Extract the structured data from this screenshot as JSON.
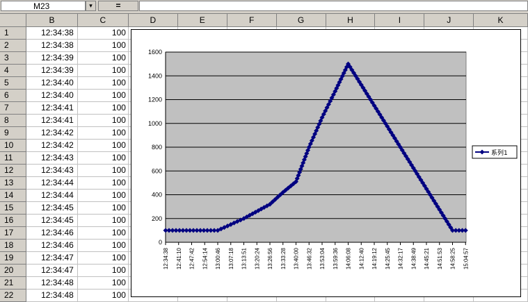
{
  "formula_bar": {
    "name_box": "M23",
    "dropdown_icon": "▾",
    "formula_label": "="
  },
  "columns": [
    "B",
    "C",
    "D",
    "E",
    "F",
    "G",
    "H",
    "I",
    "J",
    "K"
  ],
  "rows": [
    {
      "num": "1",
      "time": "12:34:38",
      "value": "100"
    },
    {
      "num": "2",
      "time": "12:34:38",
      "value": "100"
    },
    {
      "num": "3",
      "time": "12:34:39",
      "value": "100"
    },
    {
      "num": "4",
      "time": "12:34:39",
      "value": "100"
    },
    {
      "num": "5",
      "time": "12:34:40",
      "value": "100"
    },
    {
      "num": "6",
      "time": "12:34:40",
      "value": "100"
    },
    {
      "num": "7",
      "time": "12:34:41",
      "value": "100"
    },
    {
      "num": "8",
      "time": "12:34:41",
      "value": "100"
    },
    {
      "num": "9",
      "time": "12:34:42",
      "value": "100"
    },
    {
      "num": "10",
      "time": "12:34:42",
      "value": "100"
    },
    {
      "num": "11",
      "time": "12:34:43",
      "value": "100"
    },
    {
      "num": "12",
      "time": "12:34:43",
      "value": "100"
    },
    {
      "num": "13",
      "time": "12:34:44",
      "value": "100"
    },
    {
      "num": "14",
      "time": "12:34:44",
      "value": "100"
    },
    {
      "num": "15",
      "time": "12:34:45",
      "value": "100"
    },
    {
      "num": "16",
      "time": "12:34:45",
      "value": "100"
    },
    {
      "num": "17",
      "time": "12:34:46",
      "value": "100"
    },
    {
      "num": "18",
      "time": "12:34:46",
      "value": "100"
    },
    {
      "num": "19",
      "time": "12:34:47",
      "value": "100"
    },
    {
      "num": "20",
      "time": "12:34:47",
      "value": "100"
    },
    {
      "num": "21",
      "time": "12:34:48",
      "value": "100"
    },
    {
      "num": "22",
      "time": "12:34:48",
      "value": "100"
    }
  ],
  "colors": {
    "plot_background": "#c0c0c0",
    "series": "#000080",
    "header_background": "#d4d0c8"
  },
  "chart_data": {
    "type": "line",
    "title": "",
    "xlabel": "",
    "ylabel": "",
    "ylim": [
      0,
      1600
    ],
    "y_ticks": [
      "0",
      "200",
      "400",
      "600",
      "800",
      "1000",
      "1200",
      "1400",
      "1600"
    ],
    "categories": [
      "12:34:38",
      "12:41:10",
      "12:47:42",
      "12:54:14",
      "13:00:46",
      "13:07:18",
      "13:13:51",
      "13:20:24",
      "13:26:56",
      "13:33:28",
      "13:40:00",
      "13:46:32",
      "13:53:04",
      "13:59:36",
      "14:06:08",
      "14:12:40",
      "14:19:12",
      "14:25:45",
      "14:32:17",
      "14:38:49",
      "14:45:21",
      "14:51:53",
      "14:58:25",
      "15:04:57"
    ],
    "grid": true,
    "legend_position": "right",
    "series": [
      {
        "name": "系列1",
        "x": [
          0,
          4,
          6,
          8,
          9,
          10,
          11,
          12,
          13,
          14,
          16,
          18,
          20,
          22,
          23
        ],
        "values": [
          100,
          100,
          200,
          320,
          420,
          510,
          800,
          1050,
          1270,
          1500,
          1150,
          800,
          450,
          100,
          100
        ]
      }
    ]
  }
}
